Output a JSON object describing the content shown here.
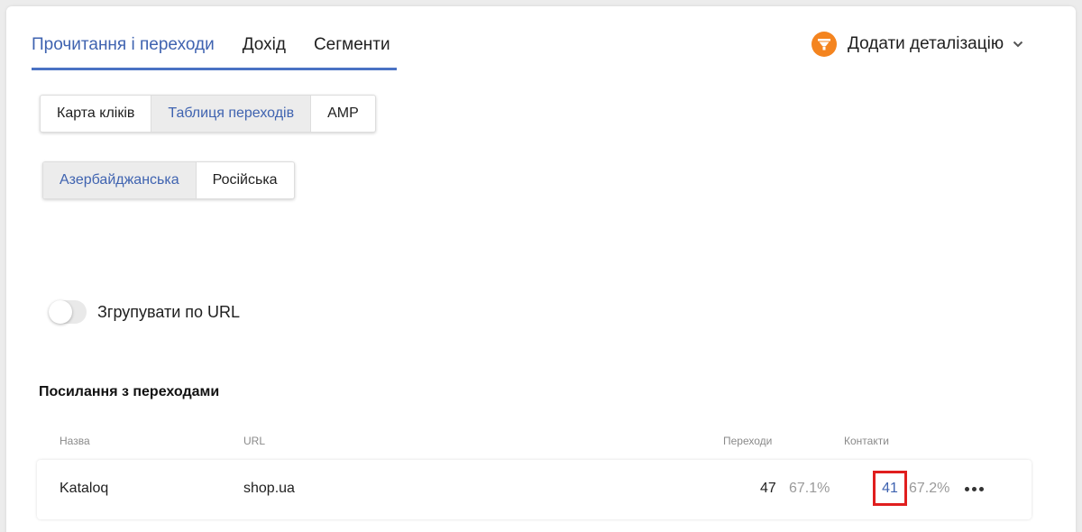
{
  "tabs": [
    {
      "label": "Прочитання і переходи",
      "active": true
    },
    {
      "label": "Дохід",
      "active": false
    },
    {
      "label": "Сегменти",
      "active": false
    }
  ],
  "add_detail": {
    "label": "Додати деталізацію",
    "icon": "funnel-icon",
    "accent": "#f4841f"
  },
  "view_modes": [
    {
      "label": "Карта кліків",
      "active": false
    },
    {
      "label": "Таблиця переходів",
      "active": true
    },
    {
      "label": "AMP",
      "active": false
    }
  ],
  "languages": [
    {
      "label": "Азербайджанська",
      "active": true
    },
    {
      "label": "Російська",
      "active": false
    }
  ],
  "group_toggle": {
    "label": "Згрупувати по URL",
    "on": false
  },
  "section_title": "Посилання з переходами",
  "table": {
    "headers": {
      "name": "Назва",
      "url": "URL",
      "transitions": "Переходи",
      "contacts": "Контакти"
    },
    "rows": [
      {
        "name": "Kataloq",
        "url": "shop.ua",
        "transitions": "47",
        "transitions_pct": "67.1%",
        "contacts": "41",
        "contacts_pct": "67.2%"
      }
    ]
  },
  "colors": {
    "accent_blue": "#3f63b0",
    "highlight_red": "#e01e1e"
  }
}
